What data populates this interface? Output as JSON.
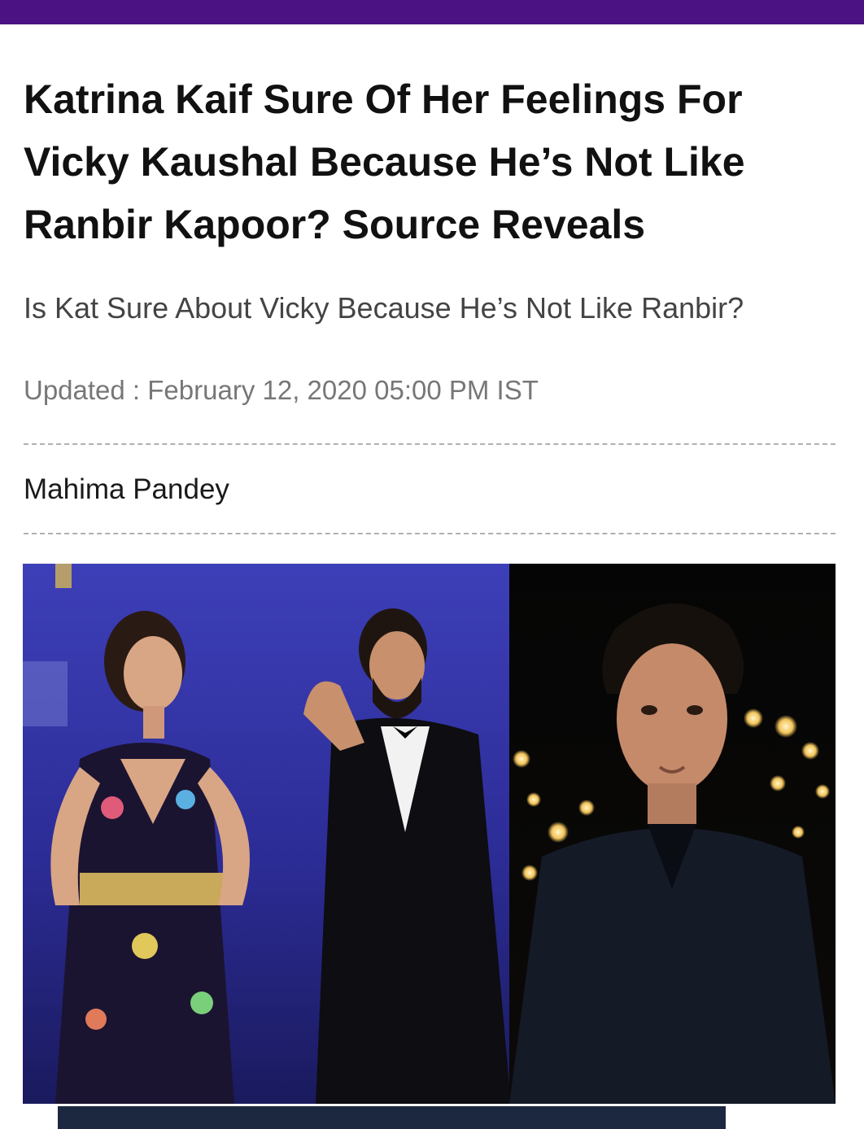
{
  "article": {
    "headline": "Katrina Kaif Sure Of Her Feelings For Vicky Kaushal Because He’s Not Like Ranbir Kapoor? Source Reveals",
    "subheading": "Is Kat Sure About Vicky Because He’s Not Like Ranbir?",
    "updated": "Updated : February 12, 2020 05:00 PM IST",
    "author": "Mahima Pandey"
  },
  "colors": {
    "top_bar": "#4b1284",
    "headline": "#111111",
    "subheading": "#444444",
    "meta": "#777777"
  }
}
